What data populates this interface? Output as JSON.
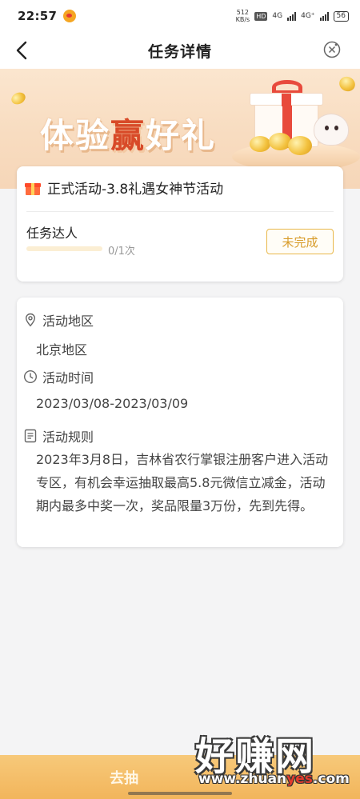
{
  "status_bar": {
    "time": "22:57",
    "net_speed_value": "512",
    "net_speed_unit": "KB/s",
    "hd_badge": "HD",
    "signal_1": "4G",
    "signal_2": "4G⁺",
    "battery": "56"
  },
  "nav": {
    "title": "任务详情"
  },
  "banner": {
    "title_part1": "体验",
    "title_highlight": "赢",
    "title_part2": "好礼"
  },
  "task": {
    "title": "正式活动-3.8礼遇女神节活动",
    "name": "任务达人",
    "progress_text": "0/1次",
    "progress_fraction": 0,
    "status_label": "未完成"
  },
  "details": {
    "region_label": "活动地区",
    "region_value": "北京地区",
    "time_label": "活动时间",
    "time_value": "2023/03/08-2023/03/09",
    "rules_label": "活动规则",
    "rules_text": "2023年3月8日，吉林省农行掌银注册客户进入活动专区，有机会幸运抽取最高5.8元微信立减金，活动期内最多中奖一次，奖品限量3万份，先到先得。"
  },
  "bottom": {
    "button_label": "去抽"
  },
  "watermark": {
    "main": "好赚网",
    "url_part1": "www.zhuan",
    "url_highlight": "yes",
    "url_part2": ".com"
  },
  "colors": {
    "accent": "#e9b84a",
    "banner_bg": "#f8dcc0",
    "highlight_red": "#d84a28",
    "bottom_button": "#f2b55b"
  }
}
